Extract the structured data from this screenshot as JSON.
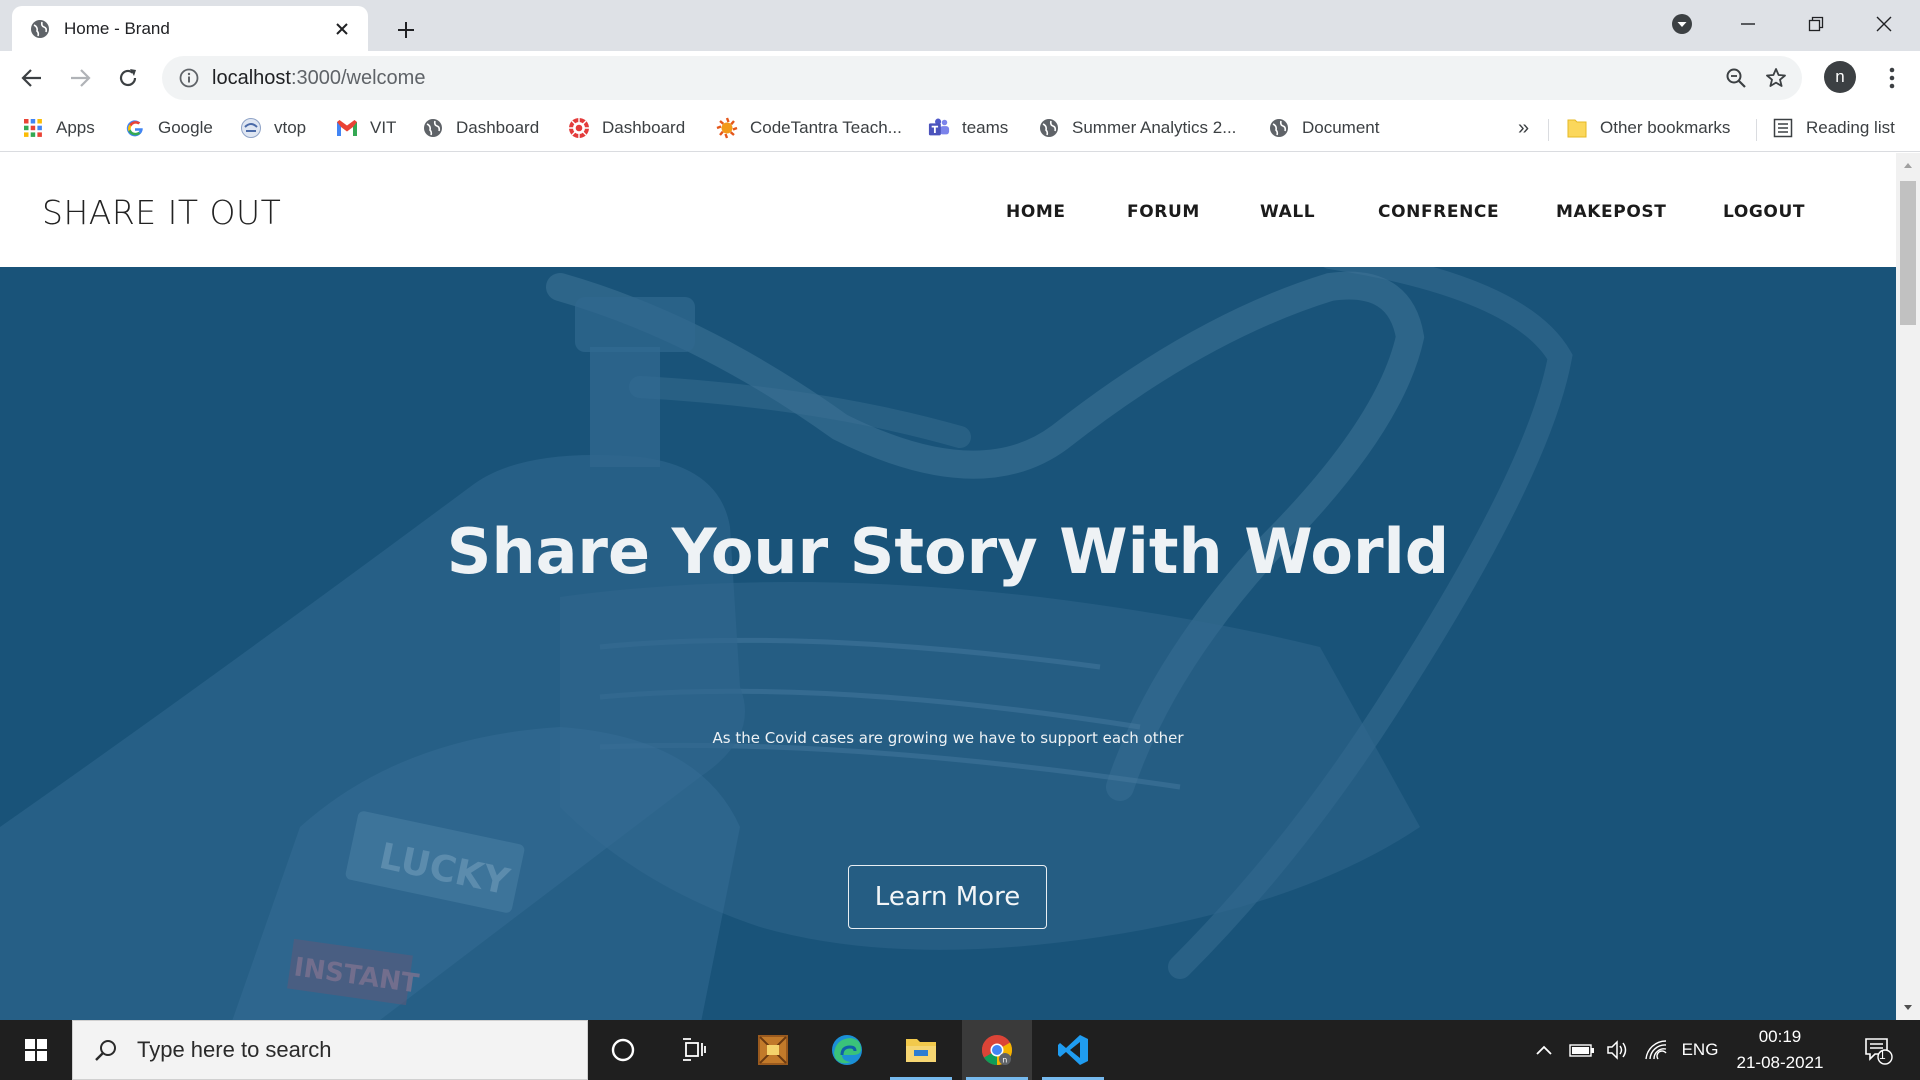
{
  "browser": {
    "tab": {
      "title": "Home - Brand",
      "icon": "globe-icon"
    },
    "address": {
      "host": "localhost",
      "path": ":3000/welcome"
    },
    "profile_initial": "n",
    "bookmarks": [
      {
        "label": "Apps",
        "icon": "apps-grid-icon"
      },
      {
        "label": "Google",
        "icon": "google-icon"
      },
      {
        "label": "vtop",
        "icon": "vtop-icon"
      },
      {
        "label": "VIT",
        "icon": "gmail-icon"
      },
      {
        "label": "Dashboard",
        "icon": "globe-icon"
      },
      {
        "label": "Dashboard",
        "icon": "red-flower-icon"
      },
      {
        "label": "CodeTantra Teach...",
        "icon": "codetantra-icon"
      },
      {
        "label": "teams",
        "icon": "teams-icon"
      },
      {
        "label": "Summer Analytics 2...",
        "icon": "globe-icon"
      },
      {
        "label": "Document",
        "icon": "globe-icon"
      }
    ],
    "bookmarks_overflow": "»",
    "other_bookmarks": "Other bookmarks",
    "reading_list": "Reading list"
  },
  "site": {
    "brand": "SHARE IT OUT",
    "nav": [
      "HOME",
      "FORUM",
      "WALL",
      "CONFRENCE",
      "MAKEPOST",
      "LOGOUT"
    ],
    "hero": {
      "title": "Share Your Story With World",
      "subtitle": "As the Covid cases are growing we have to support each other",
      "button": "Learn More"
    }
  },
  "taskbar": {
    "search_placeholder": "Type here to search",
    "language": "ENG",
    "time": "00:19",
    "date": "21-08-2021",
    "notification_count": "1"
  },
  "colors": {
    "hero_background": "#1b557b",
    "tab_strip": "#dee1e6",
    "taskbar": "#1f1f1f"
  }
}
